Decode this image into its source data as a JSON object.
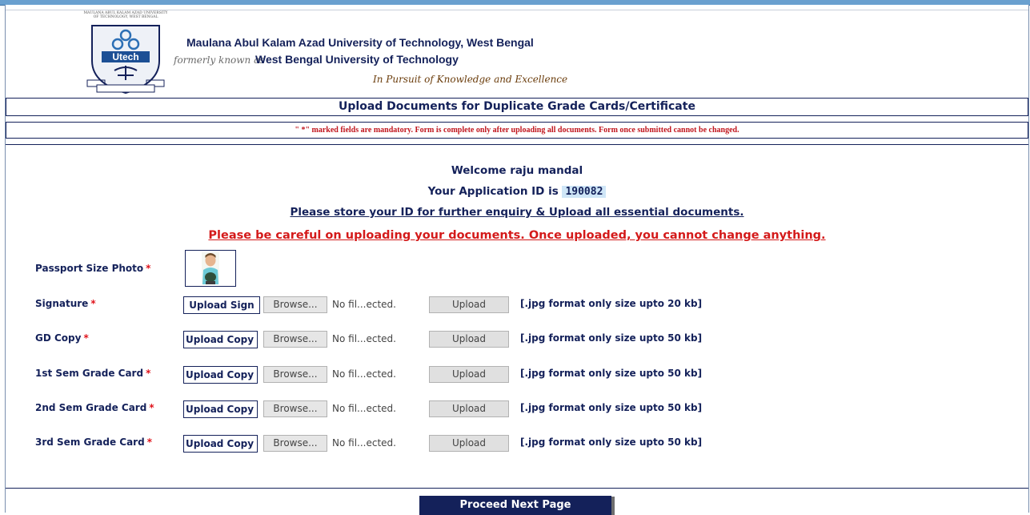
{
  "header": {
    "logo_caption": "MAULANA ABUL KALAM AZAD UNIVERSITY OF TECHNOLOGY, WEST BENGAL",
    "logo_text": "Utech",
    "university_name": "Maulana Abul Kalam Azad University of Technology, West Bengal",
    "formerly_label": "formerly known as",
    "former_name": "West Bengal University of Technology",
    "motto": "In Pursuit of Knowledge and Excellence"
  },
  "page_title": "Upload Documents for Duplicate Grade Cards/Certificate",
  "mandatory_note": "\" *\"  marked fields are mandatory. Form is complete only after uploading all documents. Form once submitted cannot be changed.",
  "welcome": "Welcome raju mandal",
  "application": {
    "label": "Your Application ID is",
    "id": "190082"
  },
  "store_notice": "Please store your ID for further enquiry & Upload all essential documents.",
  "careful_notice": "Please be careful on uploading your documents. Once uploaded, you cannot change anything.",
  "required_mark": "*",
  "photo_label": "Passport Size Photo",
  "rows": [
    {
      "label": "Signature",
      "button": "Upload Sign",
      "browse": "Browse...",
      "file": "No fil...ected.",
      "upload": "Upload",
      "hint": "[.jpg format only size upto 20 kb]"
    },
    {
      "label": "GD Copy",
      "button": "Upload Copy",
      "browse": "Browse...",
      "file": "No fil...ected.",
      "upload": "Upload",
      "hint": "[.jpg format only size upto 50 kb]"
    },
    {
      "label": "1st Sem Grade Card",
      "button": "Upload Copy",
      "browse": "Browse...",
      "file": "No fil...ected.",
      "upload": "Upload",
      "hint": "[.jpg format only size upto 50 kb]"
    },
    {
      "label": "2nd Sem Grade Card",
      "button": "Upload Copy",
      "browse": "Browse...",
      "file": "No fil...ected.",
      "upload": "Upload",
      "hint": "[.jpg format only size upto 50 kb]"
    },
    {
      "label": "3rd Sem Grade Card",
      "button": "Upload Copy",
      "browse": "Browse...",
      "file": "No fil...ected.",
      "upload": "Upload",
      "hint": "[.jpg format only size upto 50 kb]"
    }
  ],
  "proceed_label": "Proceed Next Page",
  "colors": {
    "navy": "#14215a",
    "red": "#d41a1a",
    "highlight": "#cfe6f7"
  }
}
